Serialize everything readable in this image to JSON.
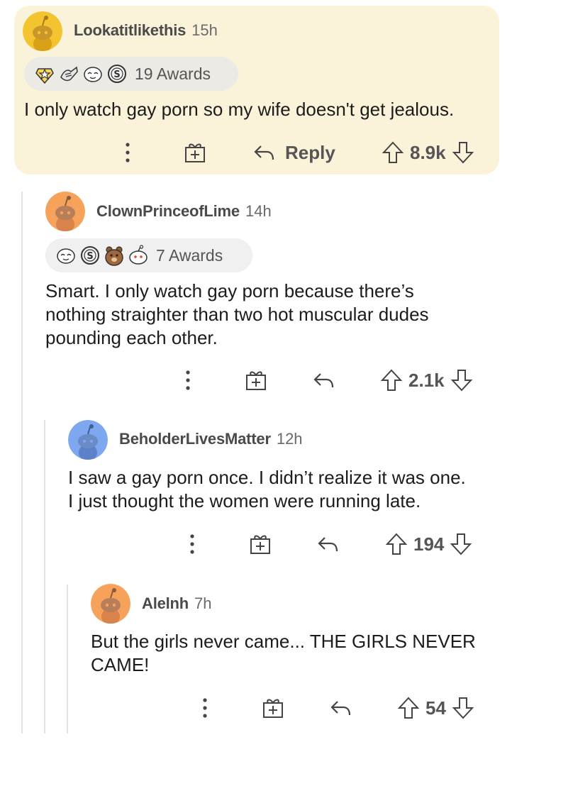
{
  "comments": [
    {
      "username": "Lookatitlikethis",
      "time": "15h",
      "awards_label": "19 Awards",
      "awards": [
        "star-award-icon",
        "helpful-hands-award-icon",
        "wholesome-face-award-icon",
        "silver-coin-award-icon"
      ],
      "body": "I only watch gay porn so my wife doesn't get jealous.",
      "reply_label": "Reply",
      "votes": "8.9k",
      "avatar_color": "#f4c430"
    },
    {
      "username": "ClownPrinceofLime",
      "time": "14h",
      "awards_label": "7 Awards",
      "awards": [
        "wholesome-face-award-icon",
        "silver-coin-award-icon",
        "bear-hug-award-icon",
        "snoo-award-icon"
      ],
      "body_lines": [
        "Smart. I only watch gay porn because there’s",
        "nothing straighter than two hot muscular dudes",
        "pounding each other."
      ],
      "votes": "2.1k",
      "avatar_color": "#f6a25a"
    },
    {
      "username": "BeholderLivesMatter",
      "time": "12h",
      "body_lines": [
        "I saw a gay porn once. I didn’t realize it was one.",
        "I just thought the women were running late."
      ],
      "votes": "194",
      "avatar_color": "#7fa7ef"
    },
    {
      "username": "Alelnh",
      "time": "7h",
      "body_lines": [
        "But the girls never came... THE GIRLS NEVER",
        "CAME!"
      ],
      "votes": "54",
      "avatar_color": "#f6a25a"
    }
  ]
}
